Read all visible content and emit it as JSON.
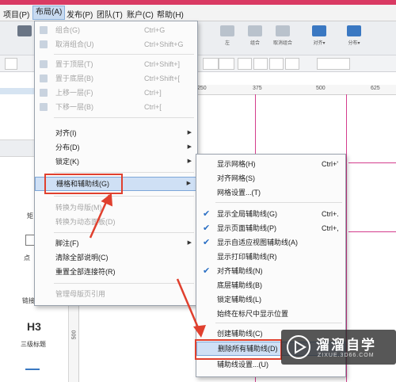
{
  "menubar": {
    "items": [
      "项目(P)",
      "布局(A)",
      "发布(P)",
      "团队(T)",
      "账户(C)",
      "帮助(H)"
    ],
    "active_index": 1
  },
  "toolbar": {
    "buttons": [
      "左",
      "组合",
      "取消组合",
      "对齐▾",
      "分布▾"
    ]
  },
  "ruler": {
    "ticks": [
      "250",
      "375",
      "500",
      "625"
    ],
    "vtick": "500"
  },
  "left_panel": {
    "items": [
      "矩",
      "点",
      "链接",
      "H3",
      "三级标题"
    ]
  },
  "layout_menu": {
    "items": [
      {
        "label": "组合(G)",
        "shortcut": "Ctrl+G",
        "disabled": true
      },
      {
        "label": "取消组合(U)",
        "shortcut": "Ctrl+Shift+G",
        "disabled": true
      },
      {
        "label": "置于顶层(T)",
        "shortcut": "Ctrl+Shift+]",
        "disabled": true
      },
      {
        "label": "置于底层(B)",
        "shortcut": "Ctrl+Shift+[",
        "disabled": true
      },
      {
        "label": "上移一层(F)",
        "shortcut": "Ctrl+]",
        "disabled": true
      },
      {
        "label": "下移一层(B)",
        "shortcut": "Ctrl+[",
        "disabled": true
      },
      {
        "label": "对齐(I)",
        "submenu": true
      },
      {
        "label": "分布(D)",
        "submenu": true
      },
      {
        "label": "锁定(K)",
        "submenu": true
      },
      {
        "label": "栅格和辅助线(G)",
        "submenu": true,
        "highlighted": true
      },
      {
        "label": "转换为母版(M)",
        "disabled": true
      },
      {
        "label": "转换为动态面板(D)",
        "disabled": true
      },
      {
        "label": "脚注(F)",
        "submenu": true
      },
      {
        "label": "清除全部说明(C)"
      },
      {
        "label": "重置全部连接符(R)"
      },
      {
        "label": "管理母版页引用",
        "disabled": true
      }
    ]
  },
  "grid_submenu": {
    "items": [
      {
        "label": "显示网格(H)",
        "shortcut": "Ctrl+'"
      },
      {
        "label": "对齐网格(S)"
      },
      {
        "label": "网格设置...(T)"
      },
      {
        "label": "显示全局辅助线(G)",
        "shortcut": "Ctrl+.",
        "checked": true
      },
      {
        "label": "显示页面辅助线(P)",
        "shortcut": "Ctrl+,",
        "checked": true
      },
      {
        "label": "显示自适应视图辅助线(A)",
        "checked": true
      },
      {
        "label": "显示打印辅助线(R)"
      },
      {
        "label": "对齐辅助线(N)",
        "checked": true
      },
      {
        "label": "底层辅助线(B)"
      },
      {
        "label": "锁定辅助线(L)"
      },
      {
        "label": "始终在标尺中显示位置"
      },
      {
        "label": "创建辅助线(C)"
      },
      {
        "label": "删除所有辅助线(D)",
        "highlighted": true
      },
      {
        "label": "辅助线设置...(U)"
      }
    ]
  },
  "watermark": {
    "title": "溜溜自学",
    "subtitle": "ZIXUE.3D66.COM"
  },
  "colors": {
    "accent": "#e0402e",
    "guide": "#d43d8d",
    "highlight": "#cfe0f5"
  }
}
